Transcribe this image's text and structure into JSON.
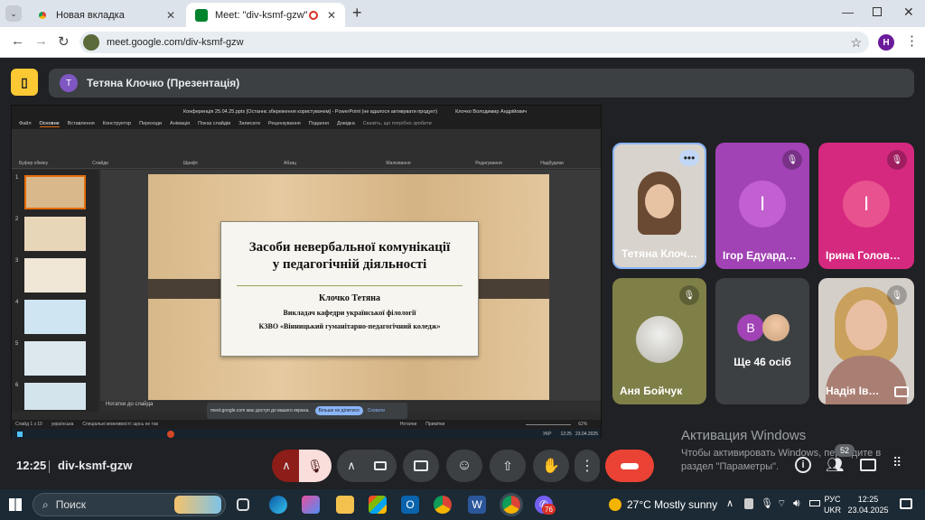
{
  "browser": {
    "tabs": [
      {
        "label": "Новая вкладка",
        "active": false
      },
      {
        "label": "Meet: \"div-ksmf-gzw\"",
        "active": true
      }
    ],
    "new_tab_label": "+",
    "url": "meet.google.com/div-ksmf-gzw",
    "profile_initial": "H"
  },
  "meet": {
    "presenter_initial": "T",
    "presenter_label": "Тетяна Клочко (Презентація)",
    "time": "12:25",
    "meeting_code": "div-ksmf-gzw",
    "participants_badge": "52",
    "tiles": [
      {
        "name": "Тетяна Клоч…",
        "initial": ""
      },
      {
        "name": "Ігор Едуард…",
        "initial": "I"
      },
      {
        "name": "Ірина Голов…",
        "initial": "I"
      },
      {
        "name": "Аня Бойчук",
        "initial": ""
      },
      {
        "name": "Ще 46 осіб",
        "initial": "B"
      },
      {
        "name": "Надія Ів…",
        "initial": ""
      }
    ],
    "activation_title": "Активация Windows",
    "activation_text": "Чтобы активировать Windows, перейдите в раздел \"Параметры\"."
  },
  "ppt": {
    "title_bar": "Конференція 25.04.25.pptx  [Останнє збереження користувачем]  -  PowerPoint (не вдалося активувати продукт)",
    "user": "Клочко Володимир Андрійович",
    "menu": [
      "Файл",
      "Основне",
      "Вставлення",
      "Конструктор",
      "Переходи",
      "Анімація",
      "Показ слайдів",
      "Записати",
      "Рецензування",
      "Подання",
      "Довідка",
      "Скажіть, що потрібно зробити"
    ],
    "groups": [
      "Буфер обміну",
      "Слайди",
      "Шрифт",
      "Абзац",
      "Малювання",
      "Редагування",
      "Надбудови"
    ],
    "notes_label": "Нотатки до слайда",
    "share_text": "meet.google.com має доступ до вашого екрана.",
    "share_stop": "Більше не ділитися",
    "share_hide": "Сховати",
    "status_left": "Слайд 1 з 10",
    "status_lang": "українська",
    "status_access": "Спеціальні можливості: щось не так",
    "status_notes": "Нотатки",
    "status_comments": "Примітки",
    "zoom": "62%",
    "thumbs": [
      "1",
      "2",
      "3",
      "4",
      "5",
      "6"
    ],
    "slide": {
      "title_line1": "Засоби невербальної комунікації",
      "title_line2": "у педагогічній діяльності",
      "author": "Клочко Тетяна",
      "position": "Викладач кафедри української філології",
      "org": "КЗВО «Вінницький гуманітарно-педагогічний коледж»"
    },
    "inner_tray": {
      "lang": "УКР",
      "time": "12:25",
      "date": "23.04.2025"
    }
  },
  "taskbar": {
    "search_label": "Поиск",
    "weather": "27°C  Mostly sunny",
    "lang_top": "РУС",
    "lang_bottom": "UKR",
    "time": "12:25",
    "date": "23.04.2025",
    "viber_badge": "76"
  },
  "colors": {
    "meet_bg": "#202124",
    "end_call": "#ea4335",
    "mic_off": "#f9dedc",
    "purple": "#a142b5",
    "pink": "#d5297f"
  }
}
